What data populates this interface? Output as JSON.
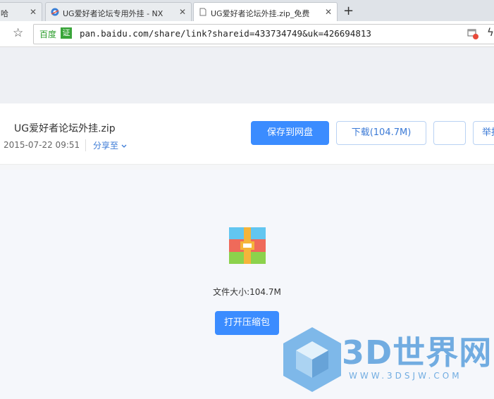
{
  "browser": {
    "tabs": [
      {
        "label": "哈"
      },
      {
        "label": "UG爱好者论坛专用外挂 - NX"
      },
      {
        "label": "UG爱好者论坛外挂.zip_免费"
      }
    ],
    "new_tab": "+",
    "site_name": "百度",
    "cert_label": "证",
    "url": "pan.baidu.com/share/link?shareid=433734749&uk=426694813"
  },
  "file": {
    "name": "UG爱好者论坛外挂.zip",
    "date": "2015-07-22 09:51",
    "share_label": "分享至",
    "save_label": "保存到网盘",
    "download_label": "下载(104.7M)",
    "report_label": "举报",
    "size_text": "文件大小:104.7M",
    "open_label": "打开压缩包"
  },
  "watermark": {
    "title": "3D世界网",
    "url": "WWW.3DSJW.COM"
  },
  "colors": {
    "accent": "#3b8cff",
    "link": "#3b7ad6",
    "watermark": "#5aa0dd"
  }
}
